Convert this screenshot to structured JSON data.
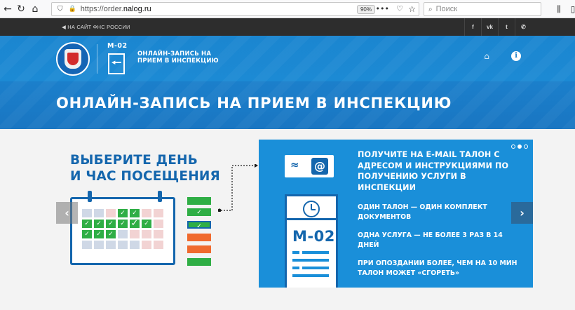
{
  "browser": {
    "url_prefix": "https://order.",
    "url_domain": "nalog.ru",
    "zoom": "90%",
    "search_placeholder": "Поиск"
  },
  "topbar": {
    "back_link": "НА САЙТ ФНС РОССИИ",
    "social": [
      {
        "icon": "facebook-icon",
        "glyph": "f"
      },
      {
        "icon": "vk-icon",
        "glyph": "vk"
      },
      {
        "icon": "twitter-icon",
        "glyph": "t"
      },
      {
        "icon": "phone-icon",
        "glyph": "✆"
      }
    ]
  },
  "header": {
    "service_code": "М-02",
    "service_name": "ОНЛАЙН-ЗАПИСЬ НА ПРИЕМ В ИНСПЕКЦИЮ",
    "page_title": "ОНЛАЙН-ЗАПИСЬ НА ПРИЕМ В ИНСПЕКЦИЮ"
  },
  "banner": {
    "left_title_line1": "ВЫБЕРИТЕ ДЕНЬ",
    "left_title_line2": "И ЧАС ПОСЕЩЕНИЯ",
    "right_title": "ПОЛУЧИТЕ НА E-MAIL ТАЛОН С АДРЕСОМ И ИНСТРУКЦИЯМИ ПО ПОЛУЧЕНИЮ УСЛУГИ В ИНСПЕКЦИИ",
    "email_tilde": "≈",
    "email_at": "@",
    "ticket_code": "М-02",
    "facts": [
      "ОДИН ТАЛОН — ОДИН КОМПЛЕКТ ДОКУМЕНТОВ",
      "ОДНА УСЛУГА — НЕ БОЛЕЕ 3 РАЗ В 14 ДНЕЙ",
      "ПРИ ОПОЗДАНИИ БОЛЕЕ, ЧЕМ НА 10 МИН ТАЛОН МОЖЕТ «СГОРЕТЬ»"
    ],
    "slides_total": 3,
    "slide_active": 2,
    "prev": "‹",
    "next": "›"
  },
  "colors": {
    "brand_blue": "#1466ad",
    "panel_blue": "#1a8fd9",
    "green": "#2fae45",
    "orange": "#f06a2e",
    "pink": "#f2d3d3"
  }
}
